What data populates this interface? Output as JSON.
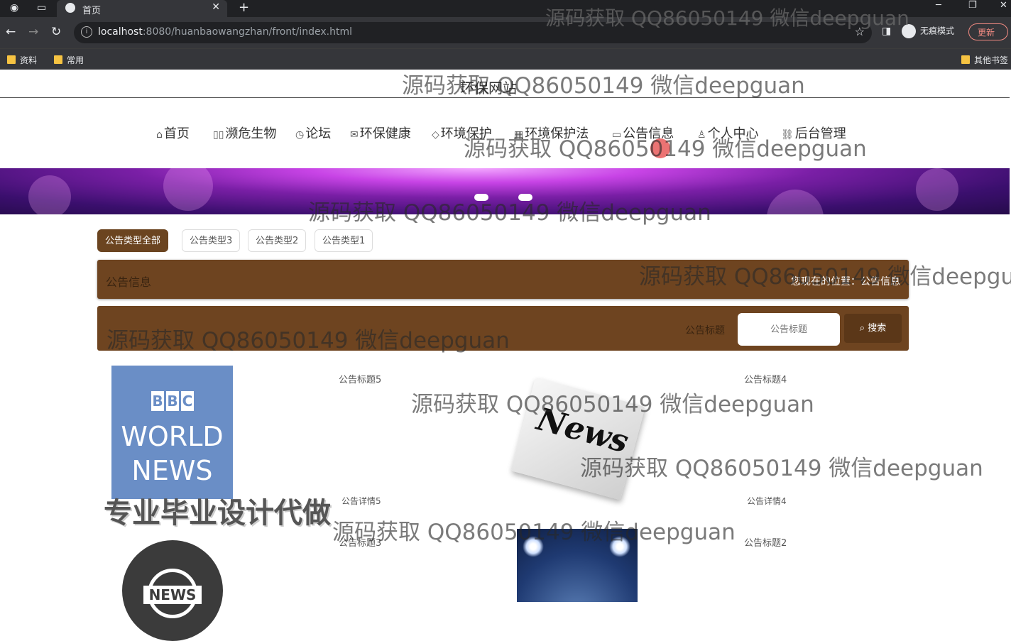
{
  "browser": {
    "tab_title": "首页",
    "url_host": "localhost",
    "url_rest": ":8080/huanbaowangzhan/front/index.html",
    "incognito_label": "无痕模式",
    "update_label": "更新",
    "bookmarks": [
      "资料",
      "常用"
    ],
    "other_bookmarks": "其他书签"
  },
  "site": {
    "title": "环保网站"
  },
  "nav": {
    "items": [
      {
        "label": "首页",
        "icon": "home-icon",
        "glyph": "⌂"
      },
      {
        "label": "濒危生物",
        "icon": "endangered-icon",
        "glyph": "▯▯"
      },
      {
        "label": "论坛",
        "icon": "power-icon",
        "glyph": "◷"
      },
      {
        "label": "环保健康",
        "icon": "mail-icon",
        "glyph": "✉"
      },
      {
        "label": "环境保护",
        "icon": "tag-icon",
        "glyph": "◇"
      },
      {
        "label": "环境保护法",
        "icon": "grid-icon",
        "glyph": "▦"
      },
      {
        "label": "公告信息",
        "icon": "chat-icon",
        "glyph": "▭"
      },
      {
        "label": "个人中心",
        "icon": "user-icon",
        "glyph": "♙"
      },
      {
        "label": "后台管理",
        "icon": "link-icon",
        "glyph": "⛓"
      }
    ]
  },
  "categories": [
    "公告类型全部",
    "公告类型3",
    "公告类型2",
    "公告类型1"
  ],
  "info_bar": {
    "title": "公告信息",
    "location": "您现在的位置：公告信息"
  },
  "search": {
    "label": "公告标题",
    "placeholder": "公告标题",
    "button": "搜索"
  },
  "cards": [
    {
      "title": "公告标题5",
      "detail": "公告详情5",
      "image": "bbc-world-news"
    },
    {
      "title": "公告标题4",
      "detail": "公告详情4",
      "image": "news-paper"
    },
    {
      "title": "公告标题3",
      "image": "news-globe"
    },
    {
      "title": "公告标题2",
      "image": "spotlights"
    }
  ],
  "images": {
    "bbc_letters": [
      "B",
      "B",
      "C"
    ],
    "bbc_line1": "WORLD",
    "bbc_line2": "NEWS",
    "paper_text": "News",
    "globe_text": "NEWS"
  },
  "watermarks": {
    "text": "源码获取 QQ86050149 微信deepguan",
    "big": "专业毕业设计代做"
  }
}
